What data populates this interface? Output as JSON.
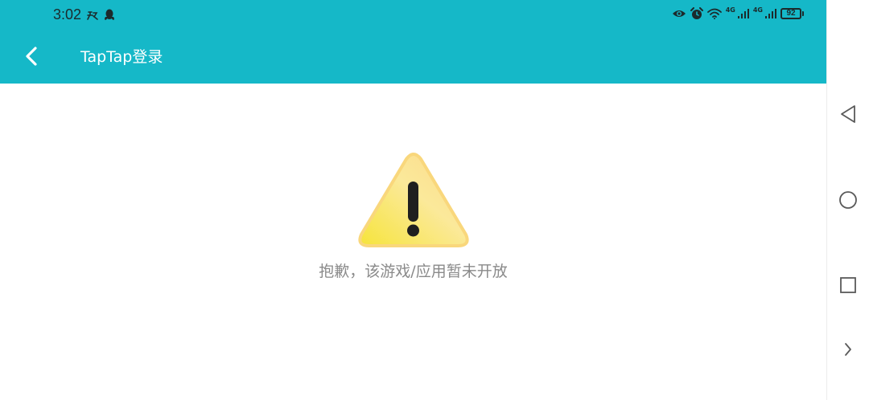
{
  "status_bar": {
    "time": "3:02",
    "network_1": "4G",
    "network_2": "4G",
    "battery": "92"
  },
  "header": {
    "title": "TapTap登录",
    "back_icon": "chevron-left-icon",
    "background_color": "#15b8c8"
  },
  "main": {
    "icon": "warning-icon",
    "message": "抱歉，该游戏/应用暂未开放"
  },
  "navigation_bar": {
    "buttons": [
      "back-triangle-icon",
      "home-circle-icon",
      "recents-square-icon",
      "expand-chevron-icon"
    ]
  }
}
